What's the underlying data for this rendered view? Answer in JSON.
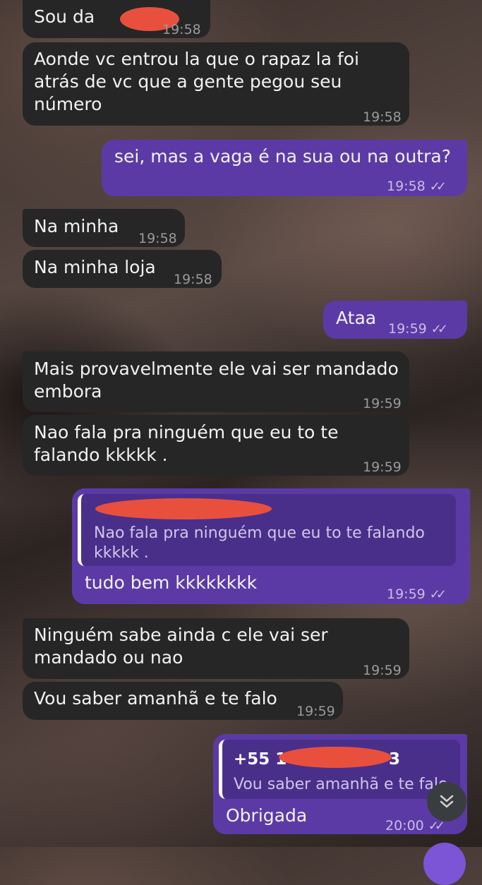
{
  "messages": [
    {
      "text": "Sou da",
      "time": "19:58"
    },
    {
      "lines": [
        "Aonde vc entrou la que o rapaz la foi",
        "atrás de vc que a gente pegou seu",
        "número"
      ],
      "time": "19:58"
    },
    {
      "text": "sei, mas a vaga é na sua ou na outra?",
      "time": "19:58"
    },
    {
      "text": "Na minha",
      "time": "19:58"
    },
    {
      "text": "Na minha loja",
      "time": "19:58"
    },
    {
      "text": "Ataa",
      "time": "19:59"
    },
    {
      "lines": [
        "Mais provavelmente ele vai ser mandado",
        "embora"
      ],
      "time": "19:59"
    },
    {
      "lines": [
        "Nao fala pra ninguém que eu to te",
        "falando kkkkk ."
      ],
      "time": "19:59"
    },
    {
      "quote_lines": [
        "Nao fala pra ninguém que eu to te falando",
        "kkkkk ."
      ],
      "text": "tudo bem kkkkkkkk",
      "time": "19:59"
    },
    {
      "lines": [
        "Ninguém sabe ainda c ele vai ser",
        "mandado ou nao"
      ],
      "time": "19:59"
    },
    {
      "text": "Vou saber amanhã e te falo",
      "time": "19:59"
    },
    {
      "quote_sender_prefix": "+55 1",
      "quote_sender_suffix": "3",
      "quote_text": "Vou saber amanhã e te falo",
      "text": "Obrigada",
      "time": "20:00"
    }
  ],
  "icons": {
    "read_receipt": "double-check-icon",
    "scroll_down": "chevron-double-down-icon"
  },
  "colors": {
    "incoming": "#262626",
    "outgoing": "#5c3aa6",
    "redaction": "#e8503d"
  }
}
